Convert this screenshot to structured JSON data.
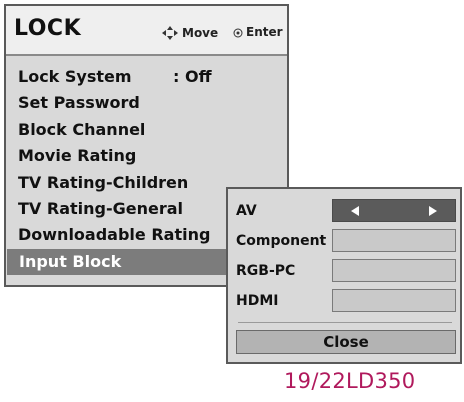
{
  "lock_menu": {
    "title": "LOCK",
    "hint_move": "Move",
    "hint_enter": "Enter",
    "items": [
      {
        "label": "Lock System",
        "value": ": Off"
      },
      {
        "label": "Set Password"
      },
      {
        "label": "Block Channel"
      },
      {
        "label": "Movie Rating"
      },
      {
        "label": "TV Rating-Children"
      },
      {
        "label": "TV Rating-General"
      },
      {
        "label": "Downloadable Rating"
      },
      {
        "label": "Input Block",
        "selected": true
      }
    ]
  },
  "input_block_popup": {
    "rows": [
      {
        "label": "AV",
        "active": true
      },
      {
        "label": "Component"
      },
      {
        "label": "RGB-PC"
      },
      {
        "label": "HDMI"
      }
    ],
    "close_label": "Close"
  },
  "model_number": "19/22LD350",
  "colors": {
    "menu_bg": "#d9d9d9",
    "selected_bg": "#7c7c7c",
    "active_field_bg": "#5b5b5b",
    "model_text": "#b0195c"
  }
}
